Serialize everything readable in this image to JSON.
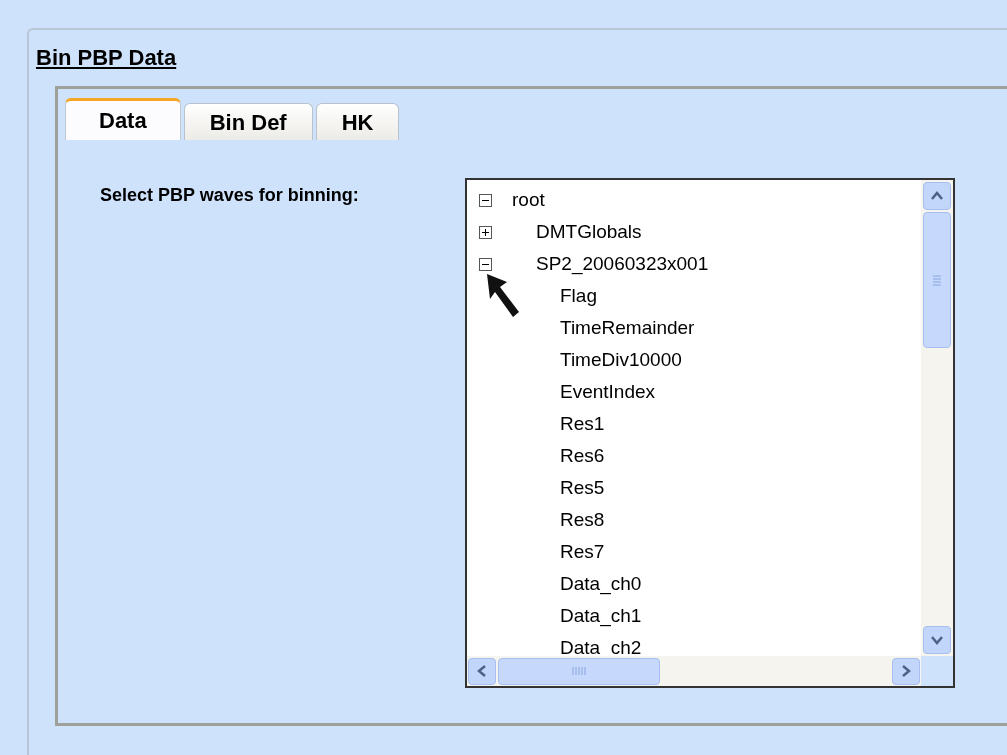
{
  "title": "Bin PBP Data",
  "tabs": [
    {
      "label": "Data",
      "selected": true
    },
    {
      "label": "Bin Def",
      "selected": false
    },
    {
      "label": "HK",
      "selected": false
    }
  ],
  "prompt": "Select PBP waves for binning:",
  "tree": [
    {
      "label": "root",
      "expanded": true,
      "children": [
        {
          "label": "DMTGlobals",
          "expanded": false
        },
        {
          "label": "SP2_20060323x001",
          "expanded": true,
          "children": [
            {
              "label": "Flag"
            },
            {
              "label": "TimeRemainder"
            },
            {
              "label": "TimeDiv10000"
            },
            {
              "label": "EventIndex"
            },
            {
              "label": "Res1"
            },
            {
              "label": "Res6"
            },
            {
              "label": "Res5"
            },
            {
              "label": "Res8"
            },
            {
              "label": "Res7"
            },
            {
              "label": "Data_ch0"
            },
            {
              "label": "Data_ch1"
            },
            {
              "label": "Data_ch2"
            }
          ]
        }
      ]
    }
  ]
}
